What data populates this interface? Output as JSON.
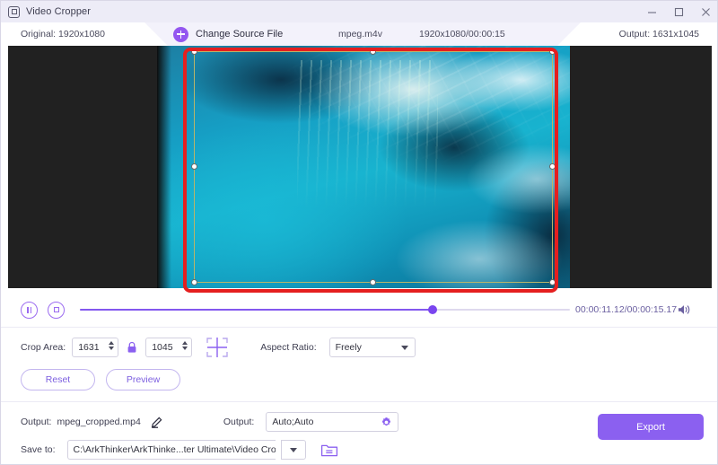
{
  "window": {
    "title": "Video Cropper",
    "app_icon": "video-cropper-icon",
    "minimize_label": "—",
    "maximize_label": "□",
    "close_label": "✕"
  },
  "infobar": {
    "original_label": "Original: 1920x1080",
    "change_source_label": "Change Source File",
    "add_icon": "plus-circle-icon",
    "file_name": "mpeg.m4v",
    "file_meta": "1920x1080/00:00:15",
    "output_label": "Output: 1631x1045"
  },
  "preview": {
    "crop_selection_name": "crop-selection-rectangle",
    "handles": [
      "top-left",
      "top-center",
      "top-right",
      "middle-left",
      "middle-right",
      "bottom-left",
      "bottom-center",
      "bottom-right"
    ],
    "annotation_color": "#e51f1f"
  },
  "transport": {
    "pause_icon": "pause-icon",
    "stop_icon": "stop-icon",
    "current_time": "00:00:11.12",
    "total_time": "00:00:15.17",
    "time_separator": "/",
    "volume_icon": "volume-icon",
    "progress_percent": 72
  },
  "crop": {
    "label": "Crop Area:",
    "width": "1631",
    "height": "1045",
    "lock_icon": "lock-icon",
    "crosshair_icon": "crosshair-icon",
    "aspect_ratio_label": "Aspect Ratio:",
    "aspect_ratio_value": "Freely"
  },
  "actions": {
    "reset_label": "Reset",
    "preview_label": "Preview"
  },
  "output": {
    "file_label": "Output:",
    "file_name": "mpeg_cropped.mp4",
    "edit_icon": "pencil-icon",
    "format_label": "Output:",
    "format_value": "Auto;Auto",
    "settings_icon": "gear-icon",
    "save_to_label": "Save to:",
    "save_path": "C:\\ArkThinker\\ArkThinke...ter Ultimate\\Video Crop",
    "dropdown_icon": "chevron-down-icon",
    "folder_icon": "folder-icon"
  },
  "export": {
    "label": "Export",
    "color": "#8b60f0"
  },
  "theme": {
    "accent": "#8b60f0",
    "titlebar_bg": "#edecf7",
    "infobar_bg": "#f3f2fb",
    "stage_bg": "#212121"
  }
}
